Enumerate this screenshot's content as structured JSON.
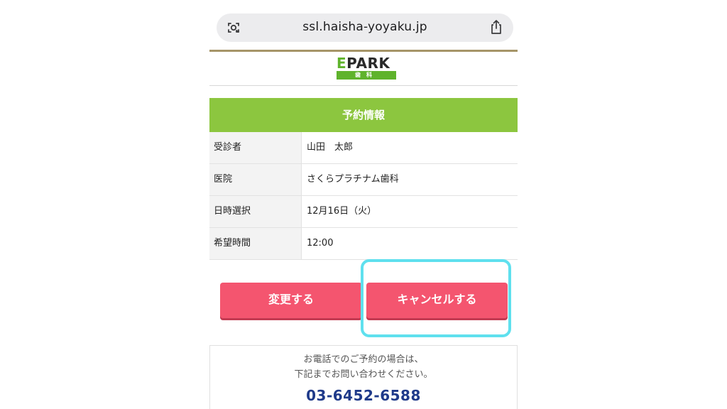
{
  "browser": {
    "url": "ssl.haisha-yoyaku.jp",
    "lens_icon": "camera-search-icon",
    "share_icon": "share-icon"
  },
  "logo": {
    "brand_e": "E",
    "brand_rest": "PARK",
    "sub": "歯科",
    "accent_color": "#5fb32c"
  },
  "section": {
    "title": "予約情報",
    "color": "#8cc63f"
  },
  "reservation": {
    "rows": [
      {
        "label": "受診者",
        "value": "山田　太郎"
      },
      {
        "label": "医院",
        "value": "さくらプラチナム歯科"
      },
      {
        "label": "日時選択",
        "value": "12月16日（火）"
      },
      {
        "label": "希望時間",
        "value": "12:00"
      }
    ]
  },
  "actions": {
    "change_label": "変更する",
    "cancel_label": "キャンセルする",
    "button_color": "#f4556f",
    "highlight_color": "#5fe0ee"
  },
  "contact": {
    "line1": "お電話でのご予約の場合は、",
    "line2": "下記までお問い合わせください。",
    "phone": "03-6452-6588",
    "phone_color": "#1f3a8a"
  }
}
